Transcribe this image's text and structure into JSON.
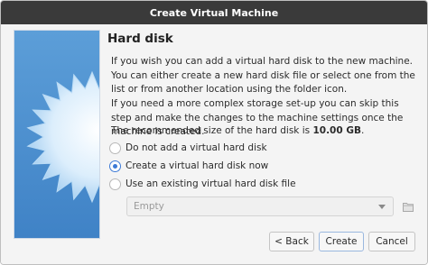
{
  "window": {
    "title": "Create Virtual Machine"
  },
  "page": {
    "heading": "Hard disk",
    "para1": "If you wish you can add a virtual hard disk to the new machine. You can either create a new hard disk file or select one from the list or from another location using the folder icon.",
    "para2": "If you need a more complex storage set-up you can skip this step and make the changes to the machine settings once the machine is created.",
    "recommended_prefix": "The recommended size of the hard disk is ",
    "recommended_size": "10.00 GB",
    "recommended_suffix": "."
  },
  "options": [
    {
      "label": "Do not add a virtual hard disk",
      "checked": false
    },
    {
      "label": "Create a virtual hard disk now",
      "checked": true
    },
    {
      "label": "Use an existing virtual hard disk file",
      "checked": false
    }
  ],
  "disk_select": {
    "value": "Empty"
  },
  "buttons": {
    "back": "< Back",
    "create": "Create",
    "cancel": "Cancel"
  },
  "colors": {
    "accent": "#3d7ad6",
    "titlebar": "#3a3a3a",
    "background": "#f4f4f4"
  },
  "icons": {
    "folder": "folder-icon",
    "side_image": "starburst-wizard-image"
  }
}
